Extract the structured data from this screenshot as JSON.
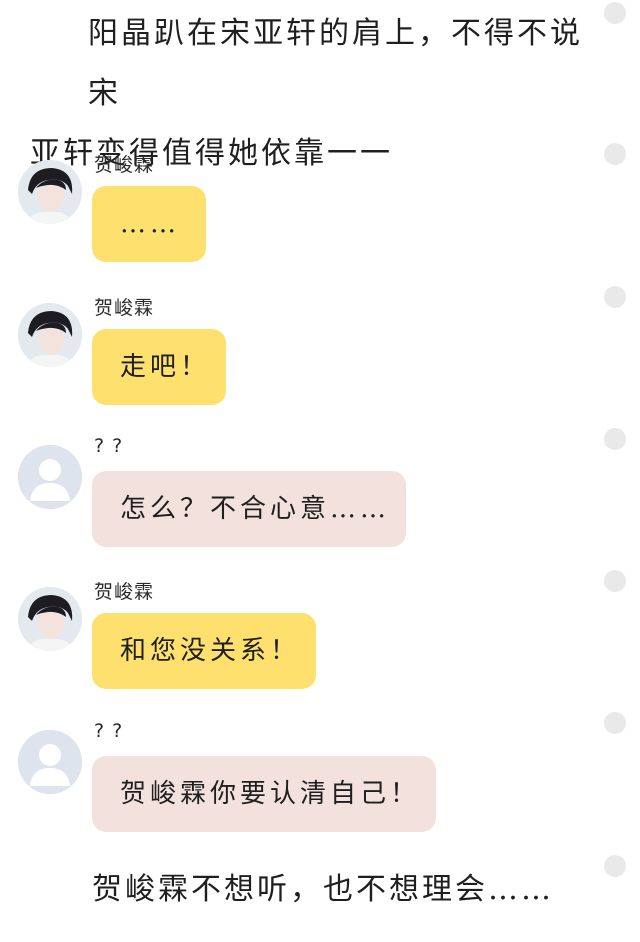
{
  "narration_top": {
    "line1": "阳晶趴在宋亚轩的肩上，不得不说宋",
    "line2": "亚轩变得值得她依靠一一"
  },
  "messages": [
    {
      "sender": "贺峻霖",
      "text": "……",
      "bubble_color": "#fde06e",
      "avatar": "photo-avatar"
    },
    {
      "sender": "贺峻霖",
      "text": "走吧！",
      "bubble_color": "#fde06e",
      "avatar": "photo-avatar"
    },
    {
      "sender": "? ?",
      "text": "怎么？不合心意……",
      "bubble_color": "#f2e1dc",
      "avatar": "default-avatar"
    },
    {
      "sender": "贺峻霖",
      "text": "和您没关系！",
      "bubble_color": "#fde06e",
      "avatar": "photo-avatar"
    },
    {
      "sender": "? ?",
      "text": "贺峻霖你要认清自己！",
      "bubble_color": "#f2e1dc",
      "avatar": "default-avatar"
    }
  ],
  "narration_bottom": "贺峻霖不想听，也不想理会……"
}
